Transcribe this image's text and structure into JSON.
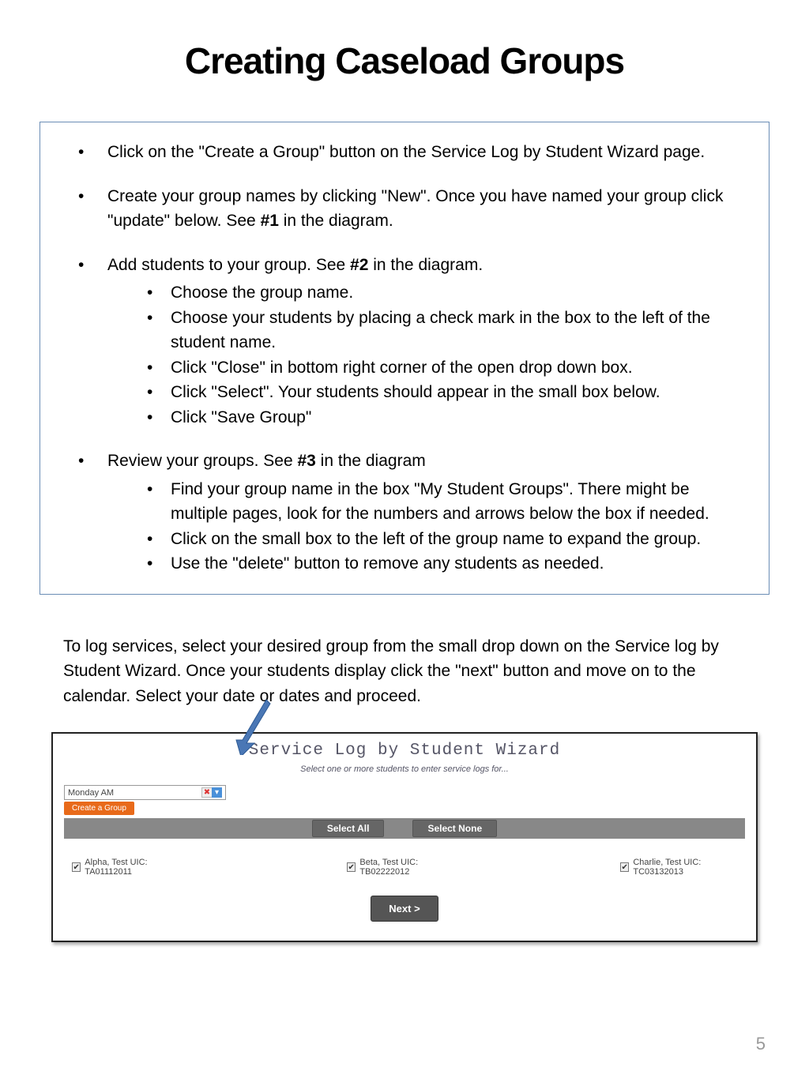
{
  "title": "Creating Caseload Groups",
  "instructions": {
    "i1": "Click on the \"Create a Group\" button on the Service Log by Student Wizard page.",
    "i2a": "Create your group names by clicking \"New\". Once you have named your group click \"update\" below. See ",
    "i2b": "#1",
    "i2c": " in the diagram.",
    "i3a": "Add students to your group. See ",
    "i3b": "#2",
    "i3c": " in the diagram.",
    "i3_sub": [
      "Choose the group name.",
      "Choose your students by placing a check mark in the box to the left of the student name.",
      "Click \"Close\" in bottom right corner of the open drop down box.",
      "Click \"Select\". Your students should appear in the small box below.",
      "Click \"Save Group\""
    ],
    "i4a": "Review your groups. See ",
    "i4b": "#3",
    "i4c": " in the diagram",
    "i4_sub": [
      "Find your group name in the box \"My Student Groups\". There might be multiple pages, look for the numbers and arrows below the box if needed.",
      "Click on the small box to the left of the group name to expand the group.",
      "Use the \"delete\" button to remove any students as needed."
    ]
  },
  "paragraph": "To log services, select your desired group from the small drop down on the Service log by Student Wizard. Once your students display click the \"next\" button and move on to the calendar. Select your date or dates and proceed.",
  "wizard": {
    "title": "Service Log by Student Wizard",
    "subtitle": "Select one or more students to enter service logs for...",
    "group_value": "Monday AM",
    "create_group_label": "Create a Group",
    "select_all": "Select All",
    "select_none": "Select None",
    "students": [
      "Alpha, Test UIC: TA01112011",
      "Beta, Test UIC: TB02222012",
      "Charlie, Test UIC: TC03132013"
    ],
    "next_label": "Next >"
  },
  "page_number": "5"
}
